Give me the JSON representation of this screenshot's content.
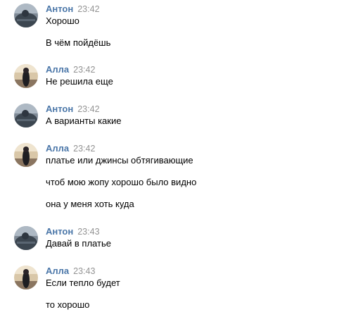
{
  "messages": [
    {
      "author": "Антон",
      "time": "23:42",
      "avatar": "anton-avatar",
      "lines": [
        "Хорошо",
        "В чём пойдёшь"
      ]
    },
    {
      "author": "Алла",
      "time": "23:42",
      "avatar": "alla-avatar",
      "lines": [
        "Не решила еще"
      ]
    },
    {
      "author": "Антон",
      "time": "23:42",
      "avatar": "anton-avatar",
      "lines": [
        "А варианты какие"
      ]
    },
    {
      "author": "Алла",
      "time": "23:42",
      "avatar": "alla-avatar",
      "lines": [
        "платье или джинсы обтягивающие",
        "чтоб мою жопу хорошо было видно",
        "она у меня хоть куда"
      ]
    },
    {
      "author": "Антон",
      "time": "23:43",
      "avatar": "anton-avatar",
      "lines": [
        "Давай в платье"
      ]
    },
    {
      "author": "Алла",
      "time": "23:43",
      "avatar": "alla-avatar",
      "lines": [
        "Если тепло будет",
        "то хорошо"
      ]
    }
  ],
  "colors": {
    "author": "#4a76a8",
    "time": "#939393",
    "text": "#000000",
    "background": "#ffffff"
  }
}
